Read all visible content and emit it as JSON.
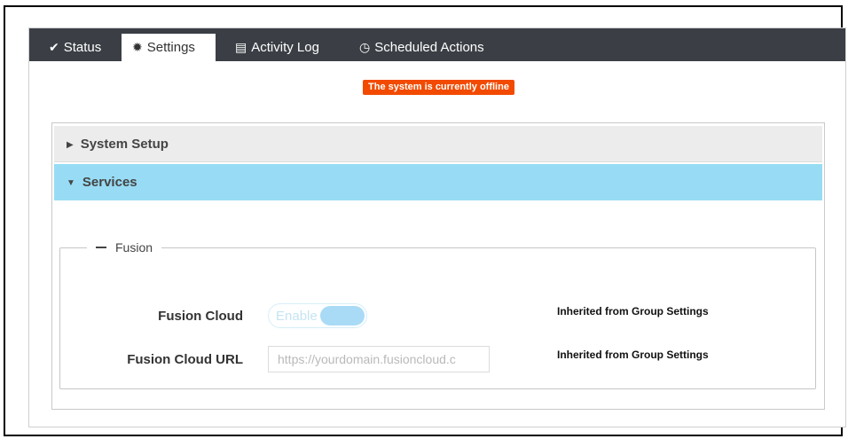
{
  "tabs": [
    {
      "label": "Status",
      "icon": "check-icon",
      "active": false
    },
    {
      "label": "Settings",
      "icon": "gear-icon",
      "active": true
    },
    {
      "label": "Activity Log",
      "icon": "list-icon",
      "active": false
    },
    {
      "label": "Scheduled Actions",
      "icon": "clock-icon",
      "active": false
    }
  ],
  "status_banner": {
    "text": "The system is currently offline",
    "color": "#f24a00"
  },
  "accordion": {
    "system_setup": {
      "label": "System Setup",
      "expanded": false
    },
    "services": {
      "label": "Services",
      "expanded": true,
      "color": "#97dcf4"
    }
  },
  "fusion": {
    "legend": "Fusion",
    "cloud": {
      "label": "Fusion Cloud",
      "toggle_label": "Enable",
      "inherited": "Inherited from Group Settings"
    },
    "url": {
      "label": "Fusion Cloud URL",
      "placeholder": "https://yourdomain.fusioncloud.c",
      "value": "",
      "inherited": "Inherited from Group Settings"
    }
  }
}
